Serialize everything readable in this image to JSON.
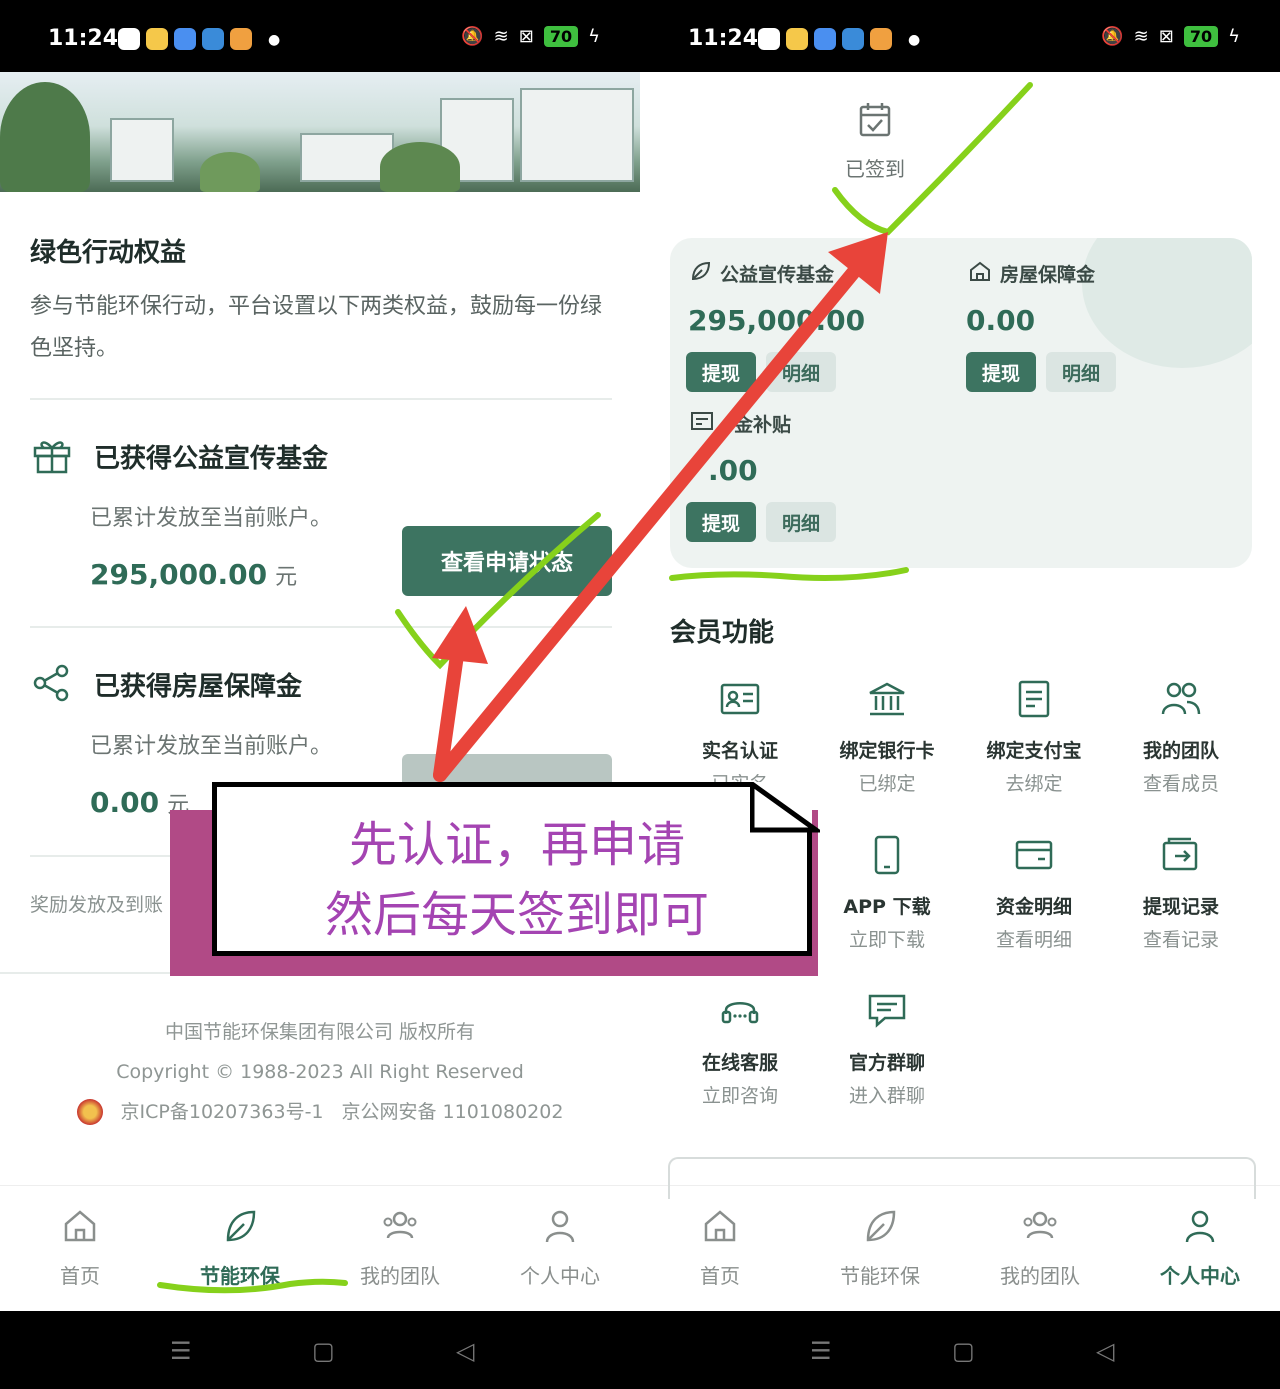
{
  "left": {
    "status_bar": {
      "time": "11:24",
      "battery": "70"
    },
    "section_title": "绿色行动权益",
    "section_desc": "参与节能环保行动，平台设置以下两类权益，鼓励每一份绿色坚持。",
    "benefits": [
      {
        "title": "已获得公益宣传基金",
        "subtitle": "已累计发放至当前账户。",
        "amount": "295,000.00",
        "unit": "元",
        "button": "查看申请状态"
      },
      {
        "title": "已获得房屋保障金",
        "subtitle": "已累计发放至当前账户。",
        "amount": "0.00",
        "unit": "元",
        "button": ""
      }
    ],
    "note": "奖励发放及到账",
    "footer": {
      "company": "中国节能环保集团有限公司 版权所有",
      "copyright": "Copyright © 1988-2023 All Right Reserved",
      "icp": "京ICP备10207363号-1",
      "police": "京公网安备 1101080202"
    },
    "tabs": [
      "首页",
      "节能环保",
      "我的团队",
      "个人中心"
    ],
    "active_tab": 1
  },
  "right": {
    "status_bar": {
      "time": "11:24",
      "battery": "70"
    },
    "signed": "已签到",
    "wallet": {
      "fund_label": "公益宣传基金",
      "fund_value": "295,000.00",
      "house_label": "房屋保障金",
      "house_value": "0.00",
      "subsidy_label": "金补贴",
      "subsidy_value": ".00",
      "withdraw": "提现",
      "detail": "明细"
    },
    "member_title": "会员功能",
    "functions": [
      {
        "title": "实名认证",
        "sub": "已实名",
        "icon": "id-card-icon"
      },
      {
        "title": "绑定银行卡",
        "sub": "已绑定",
        "icon": "bank-icon"
      },
      {
        "title": "绑定支付宝",
        "sub": "去绑定",
        "icon": "alipay-doc-icon"
      },
      {
        "title": "我的团队",
        "sub": "查看成员",
        "icon": "team-icon"
      },
      {
        "title": "APP 下载",
        "sub": "立即下载",
        "icon": "phone-icon"
      },
      {
        "title": "资金明细",
        "sub": "查看明细",
        "icon": "wallet-icon"
      },
      {
        "title": "提现记录",
        "sub": "查看记录",
        "icon": "withdraw-icon"
      },
      {
        "title": "在线客服",
        "sub": "立即咨询",
        "icon": "headset-icon"
      },
      {
        "title": "官方群聊",
        "sub": "进入群聊",
        "icon": "chat-icon"
      }
    ],
    "tabs": [
      "首页",
      "节能环保",
      "我的团队",
      "个人中心"
    ],
    "active_tab": 3
  },
  "annotation": {
    "line1": "先认证，再申请",
    "line2": "然后每天签到即可"
  },
  "colors": {
    "primary": "#3d7461",
    "accent_text": "#2f6b57",
    "callout_text": "#a444b2",
    "callout_shadow": "#b14a86",
    "arrow": "#e8443a",
    "check": "#86d11b"
  }
}
